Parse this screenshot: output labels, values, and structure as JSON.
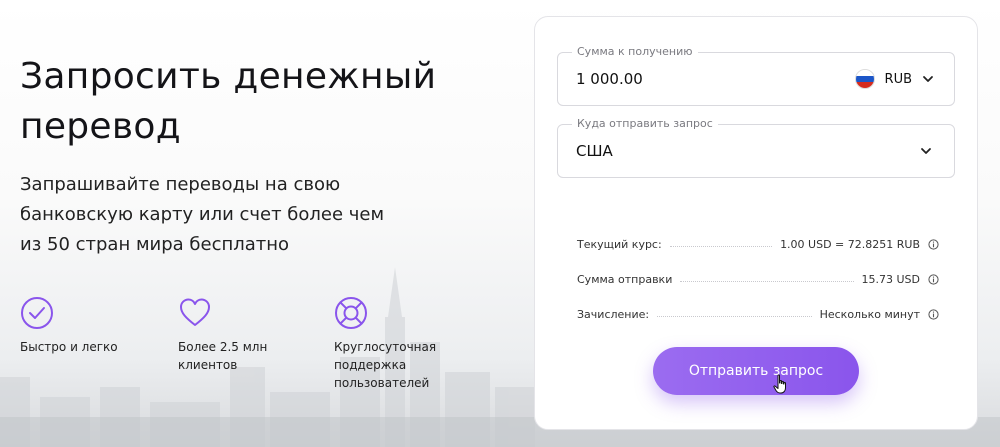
{
  "page": {
    "title": "Запросить денежный перевод",
    "subtitle": "Запрашивайте переводы на свою банковскую карту или счет более чем из 50 стран мира бесплатно"
  },
  "features": [
    {
      "icon": "check-circle-icon",
      "label": "Быстро и легко"
    },
    {
      "icon": "heart-icon",
      "label": "Более 2.5 млн клиентов"
    },
    {
      "icon": "lifebuoy-icon",
      "label": "Круглосуточная поддержка пользователей"
    }
  ],
  "form": {
    "amount": {
      "label": "Сумма к получению",
      "value": "1 000.00",
      "currency": "RUB",
      "currency_flag": "russia-flag-icon"
    },
    "destination": {
      "label": "Куда отправить запрос",
      "value": "США"
    },
    "rate": {
      "label": "Текущий курс:",
      "value": "1.00 USD = 72.8251 RUB"
    },
    "send_amount": {
      "label": "Сумма отправки",
      "value": "15.73 USD"
    },
    "crediting": {
      "label": "Зачисление:",
      "value": "Несколько минут"
    },
    "submit_label": "Отправить запрос"
  },
  "colors": {
    "accent": "#8a55ec",
    "accent_light": "#9b6cf0",
    "text": "#1b1b1f",
    "border": "#d9d9de"
  }
}
